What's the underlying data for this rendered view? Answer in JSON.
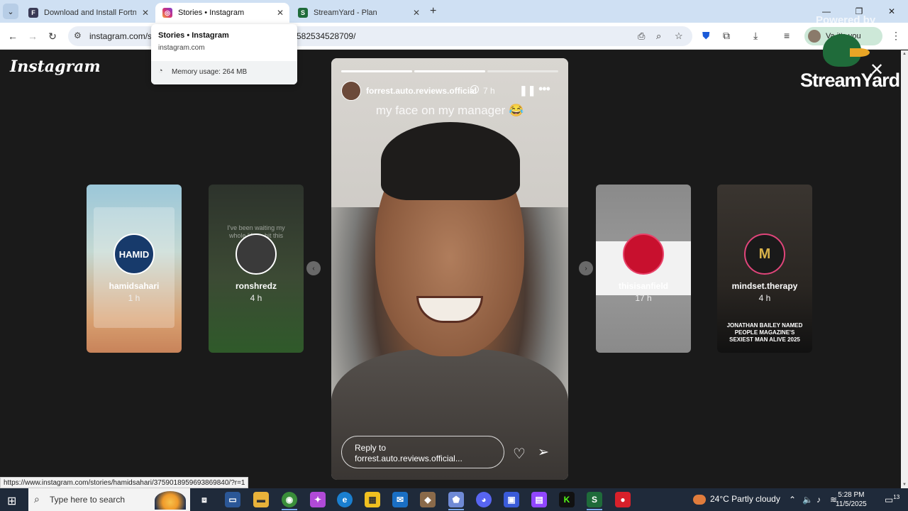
{
  "browser": {
    "tabs": [
      {
        "title": "Download and Install Fortnite T",
        "favicon": "fortnite-icon"
      },
      {
        "title": "Stories • Instagram",
        "favicon": "instagram-icon"
      },
      {
        "title": "StreamYard - Plan",
        "favicon": "streamyard-icon"
      }
    ],
    "url_visible_start": "instagram.com/sto",
    "url_visible_end": "582534528709/",
    "profile_label": "Va     it's you",
    "window_controls": [
      "—",
      "❐",
      "✕"
    ]
  },
  "hover_card": {
    "title": "Stories • Instagram",
    "domain": "instagram.com",
    "memory": "Memory usage: 264 MB"
  },
  "instagram": {
    "logo": "Instagram",
    "main_story": {
      "username": "forrest.auto.reviews.official",
      "time": "7 h",
      "caption": "my face on my manager 😂",
      "reply_placeholder_line1": "Reply to",
      "reply_placeholder_line2": "forrest.auto.reviews.official...",
      "progress_segments": [
        1.0,
        1.0,
        0.0
      ]
    },
    "side_stories": [
      {
        "name": "hamidsahari",
        "time": "1 h",
        "avatar_text": "HAMID"
      },
      {
        "name": "ronshredz",
        "time": "4 h",
        "avatar_text": ""
      },
      {
        "name": "thisisanfield",
        "time": "17 h",
        "avatar_text": ""
      },
      {
        "name": "mindset.therapy",
        "time": "4 h",
        "avatar_text": "M"
      }
    ],
    "side_card_text": {
      "ronshredz_overlay": "I've been waiting my whole life to hit this",
      "mindset_overlay": "JONATHAN BAILEY NAMED PEOPLE MAGAZINE'S SEXIEST MAN ALIVE 2025"
    }
  },
  "streamyard": {
    "powered_by": "Powered by",
    "brand": "StreamYard"
  },
  "status_link": "https://www.instagram.com/stories/hamidsahari/3759018959693869840/?r=1",
  "taskbar": {
    "search_placeholder": "Type here to search",
    "weather": "24°C  Partly cloudy",
    "time": "5:28 PM",
    "date": "11/5/2025",
    "notif_count": "13"
  }
}
